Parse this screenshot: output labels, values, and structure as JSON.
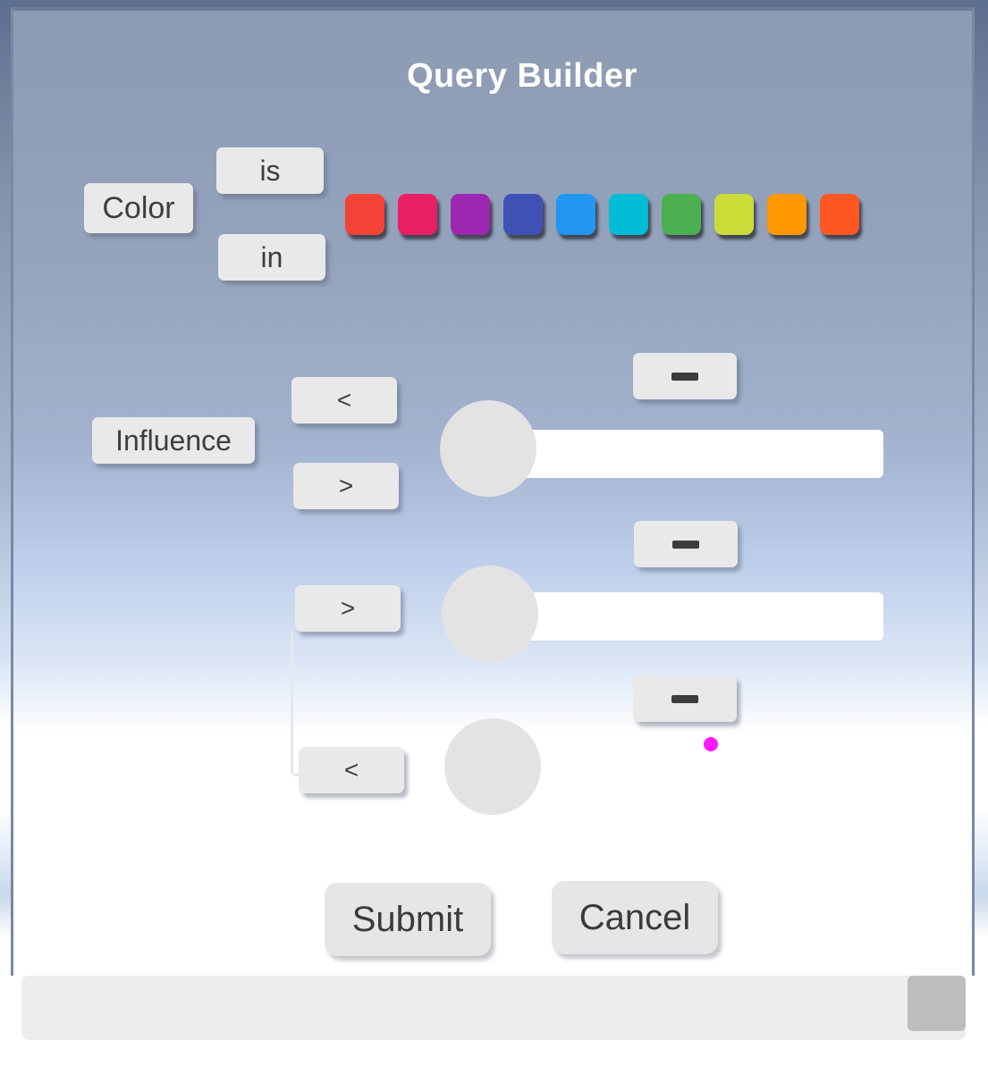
{
  "title": "Query Builder",
  "color_row": {
    "label": "Color",
    "ops": [
      "is",
      "in"
    ],
    "swatches": [
      "#f44336",
      "#e91e63",
      "#9c27b0",
      "#3f51b5",
      "#2196f3",
      "#00bcd4",
      "#4caf50",
      "#cddc39",
      "#ff9800",
      "#ff5722"
    ]
  },
  "influence_row": {
    "label": "Influence",
    "ops": [
      "<",
      ">",
      ">",
      "<"
    ],
    "sliders": [
      {
        "value": 0.0
      },
      {
        "value": 0.0
      },
      {
        "value": 0.0
      }
    ]
  },
  "actions": {
    "submit": "Submit",
    "cancel": "Cancel"
  }
}
